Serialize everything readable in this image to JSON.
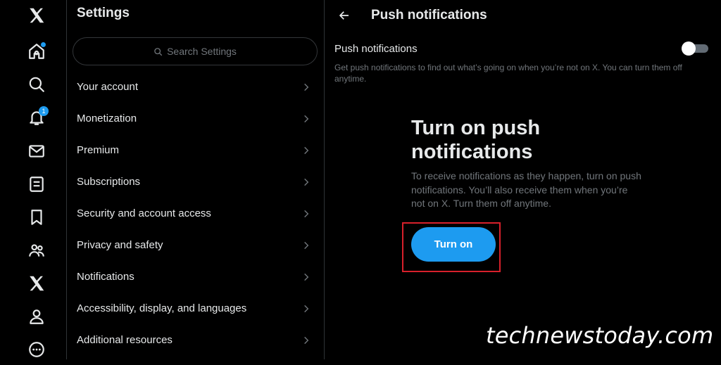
{
  "nav": {
    "items": [
      {
        "name": "x-logo"
      },
      {
        "name": "home"
      },
      {
        "name": "explore"
      },
      {
        "name": "notifications",
        "badge": "1"
      },
      {
        "name": "messages"
      },
      {
        "name": "lists"
      },
      {
        "name": "bookmarks"
      },
      {
        "name": "communities"
      },
      {
        "name": "premium"
      },
      {
        "name": "profile"
      },
      {
        "name": "more"
      }
    ]
  },
  "settings": {
    "title": "Settings",
    "search_placeholder": "Search Settings",
    "items": [
      {
        "label": "Your account"
      },
      {
        "label": "Monetization"
      },
      {
        "label": "Premium"
      },
      {
        "label": "Subscriptions"
      },
      {
        "label": "Security and account access"
      },
      {
        "label": "Privacy and safety"
      },
      {
        "label": "Notifications"
      },
      {
        "label": "Accessibility, display, and languages"
      },
      {
        "label": "Additional resources"
      }
    ]
  },
  "detail": {
    "title": "Push notifications",
    "toggle_label": "Push notifications",
    "toggle_on": false,
    "description": "Get push notifications to find out what’s going on when you’re not on X. You can turn them off anytime.",
    "promo_title": "Turn on push notifications",
    "promo_text": "To receive notifications as they happen, turn on push notifications. You’ll also receive them when you’re not on X. Turn them off anytime.",
    "button_label": "Turn on"
  },
  "watermark": "technewstoday.com",
  "colors": {
    "accent": "#1d9bf0",
    "highlight": "#d8202b",
    "background": "#000000"
  }
}
